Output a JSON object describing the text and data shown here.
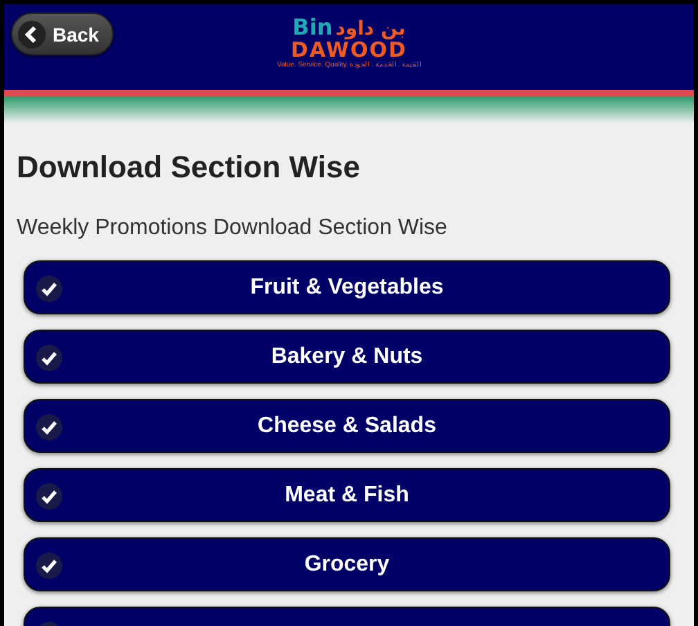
{
  "header": {
    "back_button": "Back",
    "logo": {
      "brand_top": "Bin",
      "brand_arabic": "بن داود",
      "brand_bottom": "DAWOOD",
      "tagline": "Value. Service. Quality.  القيمة . الخدمة . الجودة"
    }
  },
  "page": {
    "title": "Download Section Wise",
    "subtitle": "Weekly Promotions Download Section Wise"
  },
  "sections": [
    {
      "kind": "section",
      "label": "Fruit & Vegetables"
    },
    {
      "kind": "section",
      "label": "Bakery & Nuts"
    },
    {
      "kind": "section",
      "label": "Cheese & Salads"
    },
    {
      "kind": "section",
      "label": "Meat & Fish"
    },
    {
      "kind": "section",
      "label": "Grocery"
    },
    {
      "kind": "section"
    }
  ]
}
